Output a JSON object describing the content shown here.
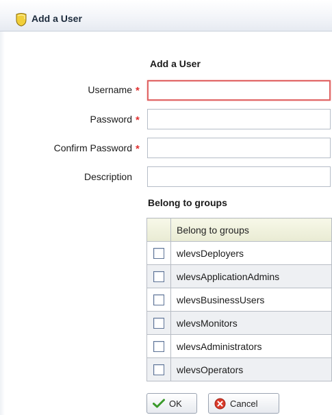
{
  "panel": {
    "title": "Add a User"
  },
  "form": {
    "title": "Add a User",
    "fields": [
      {
        "label": "Username",
        "required": true,
        "value": ""
      },
      {
        "label": "Password",
        "required": true,
        "value": ""
      },
      {
        "label": "Confirm Password",
        "required": true,
        "value": ""
      },
      {
        "label": "Description",
        "required": false,
        "value": ""
      }
    ],
    "required_marker": "*"
  },
  "groups": {
    "section_title": "Belong to groups",
    "column_header": "Belong to groups",
    "rows": [
      {
        "name": "wlevsDeployers",
        "checked": false
      },
      {
        "name": "wlevsApplicationAdmins",
        "checked": false
      },
      {
        "name": "wlevsBusinessUsers",
        "checked": false
      },
      {
        "name": "wlevsMonitors",
        "checked": false
      },
      {
        "name": "wlevsAdministrators",
        "checked": false
      },
      {
        "name": "wlevsOperators",
        "checked": false
      }
    ]
  },
  "buttons": {
    "ok_label": "OK",
    "cancel_label": "Cancel"
  },
  "colors": {
    "required": "#e03030",
    "focus_border": "#e06464",
    "ok_icon": "#3a9a2a",
    "cancel_icon": "#d93a2a"
  }
}
